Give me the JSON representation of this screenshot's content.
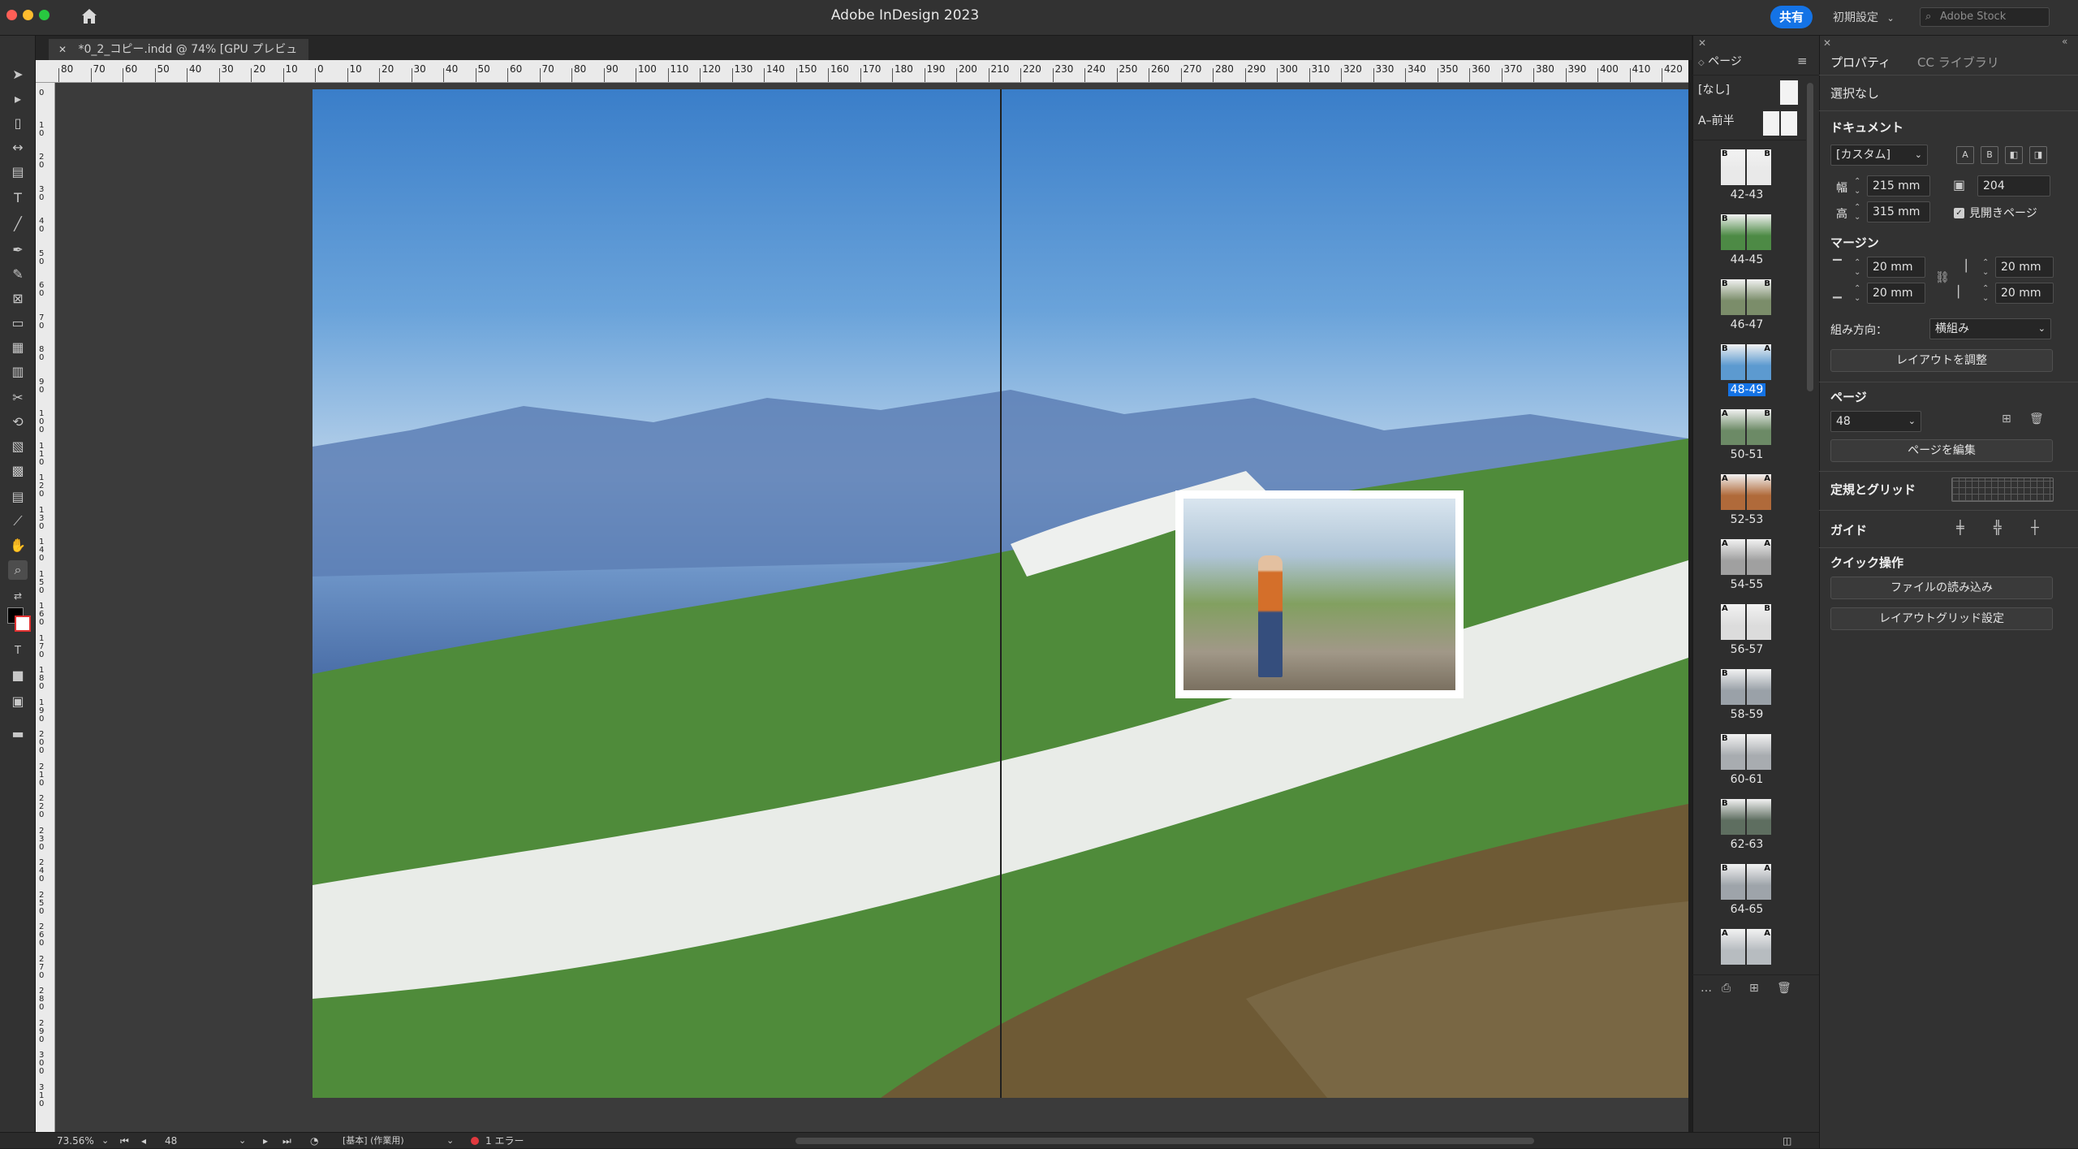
{
  "titlebar": {
    "app_title": "Adobe InDesign 2023",
    "share_label": "共有",
    "workspace_label": "初期設定",
    "search_placeholder": "Adobe Stock"
  },
  "document": {
    "tab_title": "*0_2_コピー.indd @ 74% [GPU プレビュー]",
    "close_glyph": "✕"
  },
  "ruler": {
    "h_labels": [
      "80",
      "70",
      "60",
      "50",
      "40",
      "30",
      "20",
      "10",
      "0",
      "10",
      "20",
      "30",
      "40",
      "50",
      "60",
      "70",
      "80",
      "90",
      "100",
      "110",
      "120",
      "130",
      "140",
      "150",
      "160",
      "170",
      "180",
      "190",
      "200",
      "210",
      "220",
      "230",
      "240",
      "250",
      "260",
      "270",
      "280",
      "290",
      "300",
      "310",
      "320",
      "330",
      "340",
      "350",
      "360",
      "370",
      "380",
      "390",
      "400",
      "410",
      "420"
    ],
    "v_labels": [
      "0",
      "1 0",
      "2 0",
      "3 0",
      "4 0",
      "5 0",
      "6 0",
      "7 0",
      "8 0",
      "9 0",
      "1 0 0",
      "1 1 0",
      "1 2 0",
      "1 3 0",
      "1 4 0",
      "1 5 0",
      "1 6 0",
      "1 7 0",
      "1 8 0",
      "1 9 0",
      "2 0 0",
      "2 1 0",
      "2 2 0",
      "2 3 0",
      "2 4 0",
      "2 5 0",
      "2 6 0",
      "2 7 0",
      "2 8 0",
      "2 9 0",
      "3 0 0",
      "3 1 0"
    ]
  },
  "statusbar": {
    "zoom": "73.56%",
    "page": "48",
    "profile": "[基本] (作業用)",
    "errors": "1 エラー"
  },
  "pages_panel": {
    "tab_label": "ページ",
    "masters": [
      {
        "label": "[なし]"
      },
      {
        "label": "A–前半"
      }
    ],
    "spreads": [
      {
        "label": "42-43",
        "left": "B",
        "right": "B",
        "tone": "#e9e9e9",
        "selected": false
      },
      {
        "label": "44-45",
        "left": "B",
        "right": "",
        "tone": "#4d8a45",
        "selected": false
      },
      {
        "label": "46-47",
        "left": "B",
        "right": "B",
        "tone": "#7b8d6a",
        "selected": false
      },
      {
        "label": "48-49",
        "left": "B",
        "right": "A",
        "tone": "#5c9ad0",
        "selected": true
      },
      {
        "label": "50-51",
        "left": "A",
        "right": "B",
        "tone": "#6c8a66",
        "selected": false
      },
      {
        "label": "52-53",
        "left": "A",
        "right": "A",
        "tone": "#b06a3a",
        "selected": false
      },
      {
        "label": "54-55",
        "left": "A",
        "right": "A",
        "tone": "#a0a0a0",
        "selected": false
      },
      {
        "label": "56-57",
        "left": "A",
        "right": "B",
        "tone": "#dcdcdc",
        "selected": false
      },
      {
        "label": "58-59",
        "left": "B",
        "right": "",
        "tone": "#9aa1a8",
        "selected": false
      },
      {
        "label": "60-61",
        "left": "B",
        "right": "",
        "tone": "#a8acb0",
        "selected": false
      },
      {
        "label": "62-63",
        "left": "B",
        "right": "",
        "tone": "#5e6e60",
        "selected": false
      },
      {
        "label": "64-65",
        "left": "B",
        "right": "A",
        "tone": "#9ea4aa",
        "selected": false
      },
      {
        "label": "",
        "left": "A",
        "right": "A",
        "tone": "#b7bcc0",
        "selected": false
      }
    ]
  },
  "properties": {
    "tab_properties": "プロパティ",
    "tab_cc": "CC ライブラリ",
    "selection": "選択なし",
    "doc_section": "ドキュメント",
    "preset": "[カスタム]",
    "width_label": "幅",
    "width": "215 mm",
    "height_label": "高",
    "height": "315 mm",
    "pages_count": "204",
    "facing_pages": "見開きページ",
    "margin_section": "マージン",
    "margin_top": "20 mm",
    "margin_bottom": "20 mm",
    "margin_inside": "20 mm",
    "margin_outside": "20 mm",
    "binding_label": "組み方向：",
    "binding_value": "横組み",
    "adjust_layout": "レイアウトを調整",
    "page_section": "ページ",
    "page_value": "48",
    "edit_page": "ページを編集",
    "rulers_grids": "定規とグリッド",
    "guides": "ガイド",
    "quick_actions": "クイック操作",
    "import_file": "ファイルの読み込み",
    "layout_grid": "レイアウトグリッド設定"
  }
}
